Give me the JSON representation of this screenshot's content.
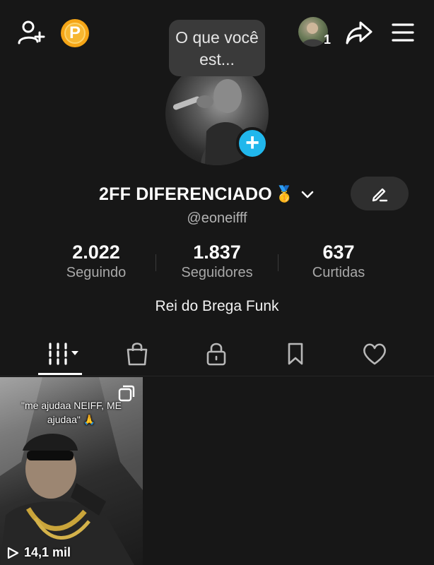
{
  "top_bar": {
    "coin_letter": "P",
    "friends_count": "1"
  },
  "story_bubble": {
    "text": "O que você est..."
  },
  "profile": {
    "display_name": "2FF DIFERENCIADO",
    "badge_emoji": "🥇",
    "username": "@eoneifff",
    "bio": "Rei do Brega Funk"
  },
  "stats": [
    {
      "value": "2.022",
      "label": "Seguindo"
    },
    {
      "value": "1.837",
      "label": "Seguidores"
    },
    {
      "value": "637",
      "label": "Curtidas"
    }
  ],
  "tabs": [
    {
      "icon": "grid-icon",
      "active": true
    },
    {
      "icon": "shopping-bag-icon",
      "active": false
    },
    {
      "icon": "lock-icon",
      "active": false
    },
    {
      "icon": "bookmark-icon",
      "active": false
    },
    {
      "icon": "heart-icon",
      "active": false
    }
  ],
  "videos": [
    {
      "caption": "\"me ajudaa NEIFF, ME ajudaa\" 🙏",
      "views": "14,1 mil"
    }
  ],
  "colors": {
    "background": "#171717",
    "accent_blue": "#21b7ec",
    "coin": "#f5a516",
    "muted_text": "#a8a8a8"
  }
}
